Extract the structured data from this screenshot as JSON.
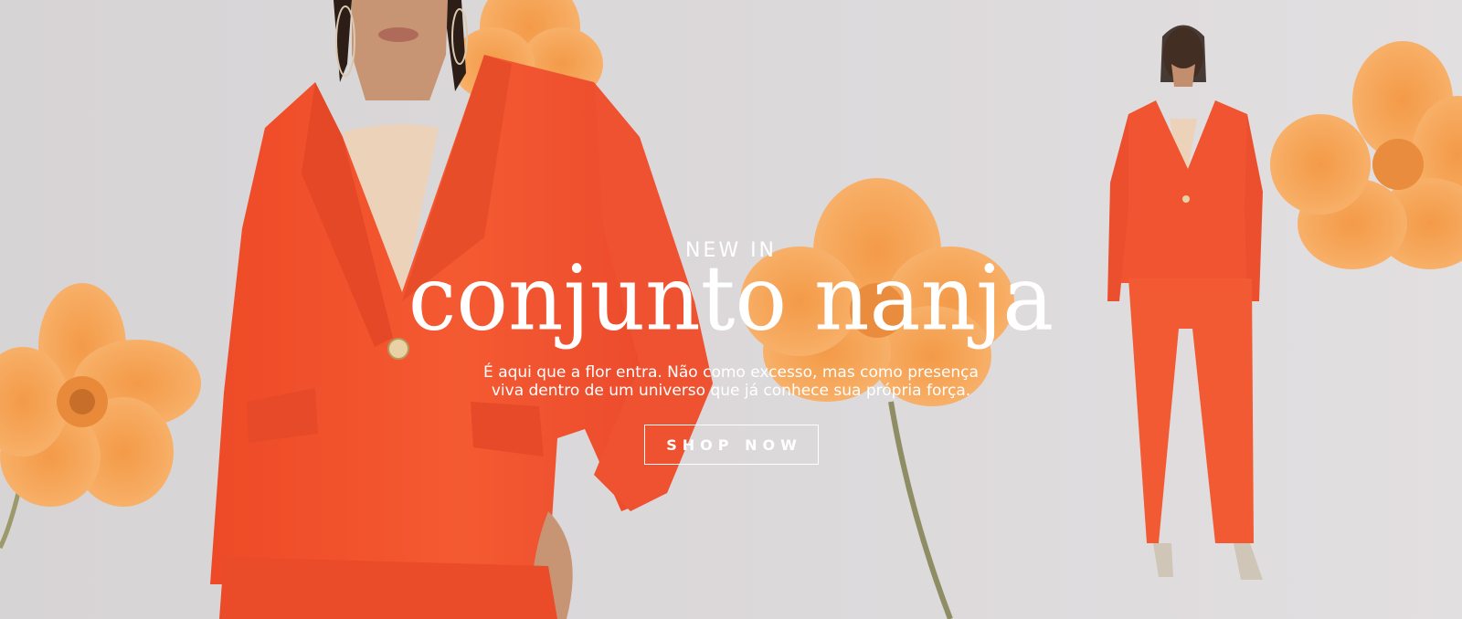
{
  "hero": {
    "eyebrow": "NEW IN",
    "title": "conjunto nanja",
    "description_lines": [
      "É aqui que a flor entra. Não como excesso, mas como presença",
      "viva dentro de um universo que já conhece sua própria força."
    ],
    "cta_label": "SHOP NOW"
  },
  "colors": {
    "background": "#d9d6d8",
    "suit": "#f2542d",
    "flower": "#f7a55a",
    "text": "#ffffff"
  }
}
